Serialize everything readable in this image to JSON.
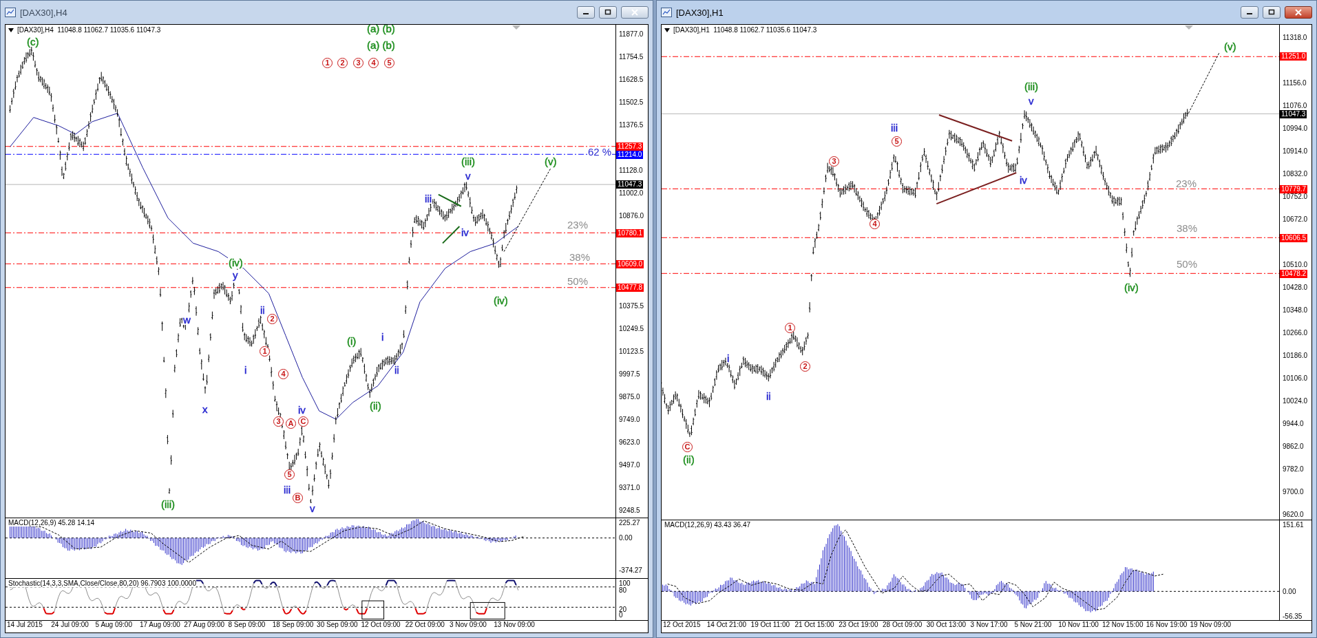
{
  "windows": [
    {
      "title": "[DAX30],H4",
      "active": false,
      "header": "[DAX30],H4  11048.8 11062.7 11035.6 11047.3",
      "price_ticks": [
        "11877.0",
        "11754.5",
        "11628.5",
        "11502.5",
        "11376.5",
        "11128.0",
        "11002.0",
        "10876.0",
        "10375.5",
        "10249.5",
        "10123.5",
        "9997.5",
        "9875.0",
        "9749.0",
        "9623.0",
        "9497.0",
        "9371.0",
        "9248.5"
      ],
      "price_tags": [
        {
          "text": "11257.3",
          "kind": "level",
          "color": "#ff0000"
        },
        {
          "text": "11214.0",
          "kind": "level",
          "color": "#0000ff"
        },
        {
          "text": "11047.3",
          "kind": "current",
          "color": "#000000"
        },
        {
          "text": "10780.1",
          "kind": "level",
          "color": "#ff0000"
        },
        {
          "text": "10609.0",
          "kind": "level",
          "color": "#ff0000"
        },
        {
          "text": "10477.8",
          "kind": "level",
          "color": "#ff0000"
        }
      ],
      "labels": [
        {
          "text": "(c)",
          "kind": "wave",
          "color": "#1f8f1f"
        },
        {
          "text": "(a) (b)",
          "kind": "wave",
          "color": "#1f8f1f"
        },
        {
          "text": "(a) (b)",
          "kind": "wave",
          "color": "#1f8f1f"
        },
        {
          "text": "1",
          "kind": "circled",
          "color": "#c81414"
        },
        {
          "text": "2",
          "kind": "circled",
          "color": "#c81414"
        },
        {
          "text": "3",
          "kind": "circled",
          "color": "#c81414"
        },
        {
          "text": "4",
          "kind": "circled",
          "color": "#c81414"
        },
        {
          "text": "5",
          "kind": "circled",
          "color": "#c81414"
        },
        {
          "text": "62 %",
          "kind": "fib",
          "color": "#2a2ad0"
        },
        {
          "text": "(v)",
          "kind": "wave",
          "color": "#1f8f1f"
        },
        {
          "text": "(iii)",
          "kind": "wave",
          "color": "#1f8f1f"
        },
        {
          "text": "v",
          "kind": "wave",
          "color": "#2a2ad0"
        },
        {
          "text": "iii",
          "kind": "wave",
          "color": "#2a2ad0"
        },
        {
          "text": "iv",
          "kind": "wave",
          "color": "#2a2ad0"
        },
        {
          "text": "23%",
          "kind": "fib",
          "color": "#8c8c8c"
        },
        {
          "text": "38%",
          "kind": "fib",
          "color": "#8c8c8c"
        },
        {
          "text": "50%",
          "kind": "fib",
          "color": "#8c8c8c"
        },
        {
          "text": "(iv)",
          "kind": "wave",
          "color": "#1f8f1f"
        },
        {
          "text": "(iv)",
          "kind": "wave",
          "color": "#1f8f1f"
        },
        {
          "text": "y",
          "kind": "wave",
          "color": "#2a2ad0"
        },
        {
          "text": "w",
          "kind": "wave",
          "color": "#2a2ad0"
        },
        {
          "text": "ii",
          "kind": "wave",
          "color": "#2a2ad0"
        },
        {
          "text": "2",
          "kind": "circled",
          "color": "#c81414"
        },
        {
          "text": "1",
          "kind": "circled",
          "color": "#c81414"
        },
        {
          "text": "i",
          "kind": "wave",
          "color": "#2a2ad0"
        },
        {
          "text": "x",
          "kind": "wave",
          "color": "#2a2ad0"
        },
        {
          "text": "4",
          "kind": "circled",
          "color": "#c81414"
        },
        {
          "text": "iv",
          "kind": "wave",
          "color": "#2a2ad0"
        },
        {
          "text": "3",
          "kind": "circled",
          "color": "#c81414"
        },
        {
          "text": "A",
          "kind": "circled",
          "color": "#c81414"
        },
        {
          "text": "C",
          "kind": "circled",
          "color": "#c81414"
        },
        {
          "text": "5",
          "kind": "circled",
          "color": "#c81414"
        },
        {
          "text": "iii",
          "kind": "wave",
          "color": "#2a2ad0"
        },
        {
          "text": "B",
          "kind": "circled",
          "color": "#c81414"
        },
        {
          "text": "v",
          "kind": "wave",
          "color": "#2a2ad0"
        },
        {
          "text": "(iii)",
          "kind": "wave",
          "color": "#1f8f1f"
        },
        {
          "text": "(i)",
          "kind": "wave",
          "color": "#1f8f1f"
        },
        {
          "text": "i",
          "kind": "wave",
          "color": "#2a2ad0"
        },
        {
          "text": "ii",
          "kind": "wave",
          "color": "#2a2ad0"
        },
        {
          "text": "(ii)",
          "kind": "wave",
          "color": "#1f8f1f"
        }
      ],
      "macd": {
        "label": "MACD(12,26,9) 45.28 14.14",
        "ticks": [
          "225.27",
          "0.00",
          "-374.27"
        ]
      },
      "stochastic": {
        "label": "Stochastic(14,3,3,SMA,Close/Close,80,20) 96.7903 100.0000",
        "ticks": [
          "100",
          "80",
          "20",
          "0"
        ]
      },
      "time_ticks": [
        "14 Jul 2015",
        "24 Jul 09:00",
        "5 Aug 09:00",
        "17 Aug 09:00",
        "27 Aug 09:00",
        "8 Sep 09:00",
        "18 Sep 09:00",
        "30 Sep 09:00",
        "12 Oct 09:00",
        "22 Oct 09:00",
        "3 Nov 09:00",
        "13 Nov 09:00"
      ]
    },
    {
      "title": "[DAX30],H1",
      "active": true,
      "header": "[DAX30],H1  11048.8 11062.7 11035.6 11047.3",
      "price_ticks": [
        "11318.0",
        "11156.0",
        "11076.0",
        "10994.0",
        "10914.0",
        "10832.0",
        "10752.0",
        "10672.0",
        "10510.0",
        "10428.0",
        "10348.0",
        "10266.0",
        "10186.0",
        "10106.0",
        "10024.0",
        "9944.0",
        "9862.0",
        "9782.0",
        "9700.0",
        "9620.0"
      ],
      "price_tags": [
        {
          "text": "11251.0",
          "kind": "level",
          "color": "#ff0000"
        },
        {
          "text": "11047.3",
          "kind": "current",
          "color": "#000000"
        },
        {
          "text": "10779.7",
          "kind": "level",
          "color": "#ff0000"
        },
        {
          "text": "10606.5",
          "kind": "level",
          "color": "#ff0000"
        },
        {
          "text": "10478.2",
          "kind": "level",
          "color": "#ff0000"
        }
      ],
      "labels": [
        {
          "text": "(v)",
          "kind": "wave",
          "color": "#1f8f1f"
        },
        {
          "text": "(iii)",
          "kind": "wave",
          "color": "#1f8f1f"
        },
        {
          "text": "v",
          "kind": "wave",
          "color": "#2a2ad0"
        },
        {
          "text": "iii",
          "kind": "wave",
          "color": "#2a2ad0"
        },
        {
          "text": "5",
          "kind": "circled",
          "color": "#c81414"
        },
        {
          "text": "3",
          "kind": "circled",
          "color": "#c81414"
        },
        {
          "text": "4",
          "kind": "circled",
          "color": "#c81414"
        },
        {
          "text": "iv",
          "kind": "wave",
          "color": "#2a2ad0"
        },
        {
          "text": "23%",
          "kind": "fib",
          "color": "#8c8c8c"
        },
        {
          "text": "38%",
          "kind": "fib",
          "color": "#8c8c8c"
        },
        {
          "text": "50%",
          "kind": "fib",
          "color": "#8c8c8c"
        },
        {
          "text": "(iv)",
          "kind": "wave",
          "color": "#1f8f1f"
        },
        {
          "text": "1",
          "kind": "circled",
          "color": "#c81414"
        },
        {
          "text": "2",
          "kind": "circled",
          "color": "#c81414"
        },
        {
          "text": "i",
          "kind": "wave",
          "color": "#2a2ad0"
        },
        {
          "text": "ii",
          "kind": "wave",
          "color": "#2a2ad0"
        },
        {
          "text": "C",
          "kind": "circled",
          "color": "#c81414"
        },
        {
          "text": "(ii)",
          "kind": "wave",
          "color": "#1f8f1f"
        }
      ],
      "macd": {
        "label": "MACD(12,26,9) 43.43 36.47",
        "ticks": [
          "151.61",
          "0.00",
          "-56.35"
        ]
      },
      "time_ticks": [
        "12 Oct 2015",
        "14 Oct 21:00",
        "19 Oct 11:00",
        "21 Oct 15:00",
        "23 Oct 19:00",
        "28 Oct 09:00",
        "30 Oct 13:00",
        "3 Nov 17:00",
        "5 Nov 21:00",
        "10 Nov 11:00",
        "12 Nov 15:00",
        "16 Nov 19:00",
        "19 Nov 09:00"
      ]
    }
  ]
}
